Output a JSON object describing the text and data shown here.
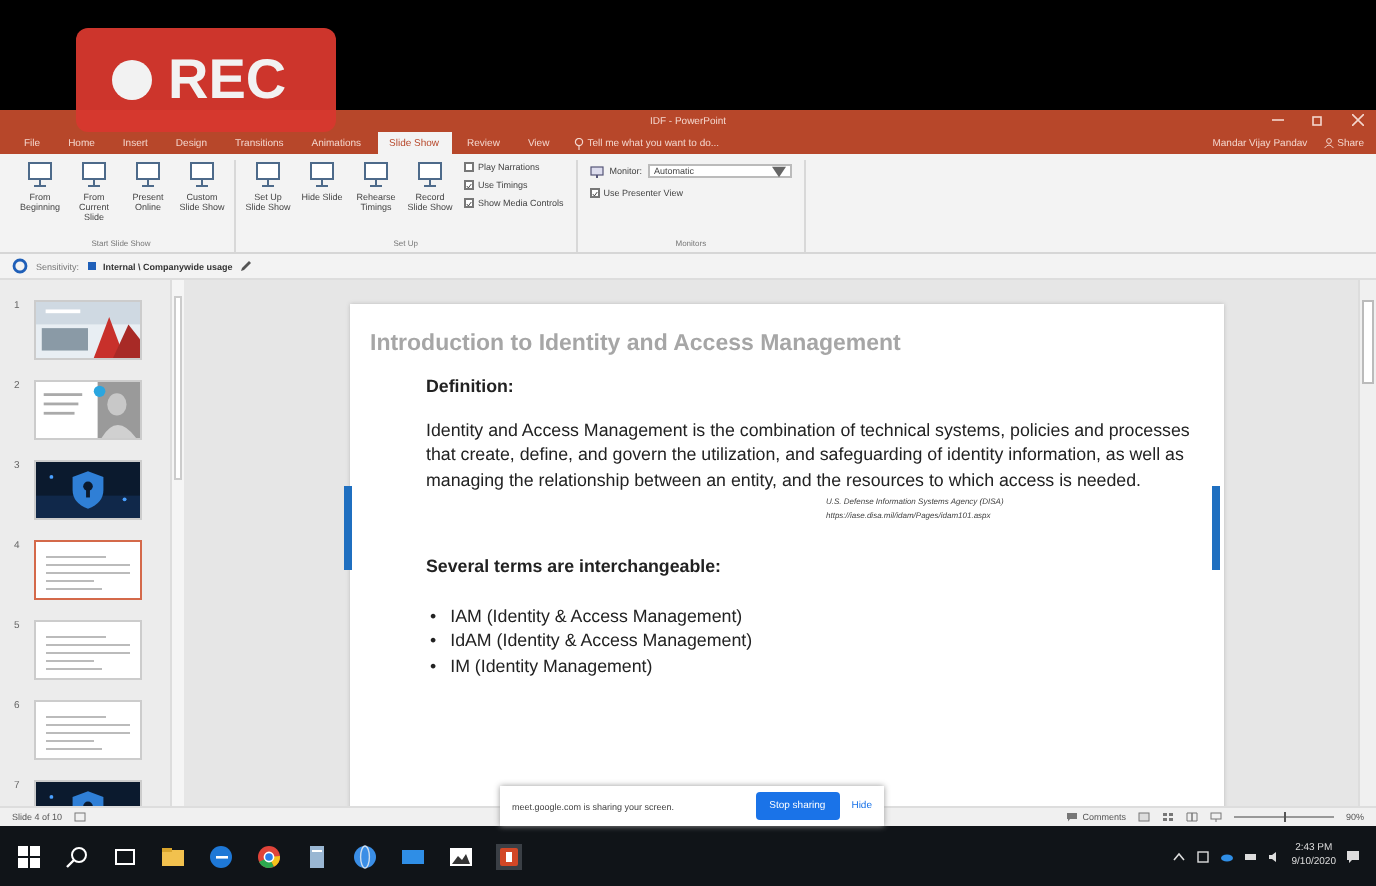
{
  "recording": {
    "label": "REC"
  },
  "window": {
    "title": "IDF - PowerPoint",
    "user": "Mandar Vijay Pandav",
    "share": "Share"
  },
  "menu_tabs": [
    {
      "label": "File",
      "selected": false
    },
    {
      "label": "Home",
      "selected": false
    },
    {
      "label": "Insert",
      "selected": false
    },
    {
      "label": "Design",
      "selected": false
    },
    {
      "label": "Transitions",
      "selected": false
    },
    {
      "label": "Animations",
      "selected": false
    },
    {
      "label": "Slide Show",
      "selected": true
    },
    {
      "label": "Review",
      "selected": false
    },
    {
      "label": "View",
      "selected": false
    }
  ],
  "tell_me": {
    "placeholder": "Tell me what you want to do..."
  },
  "ribbon_groups": [
    {
      "label": "Start Slide Show",
      "items": [
        {
          "kind": "button",
          "label": "From Beginning"
        },
        {
          "kind": "button",
          "label": "From Current Slide"
        },
        {
          "kind": "button",
          "label": "Present Online"
        },
        {
          "kind": "button",
          "label": "Custom Slide Show"
        }
      ]
    },
    {
      "label": "Set Up",
      "items": [
        {
          "kind": "button",
          "label": "Set Up Slide Show"
        },
        {
          "kind": "button",
          "label": "Hide Slide"
        },
        {
          "kind": "button",
          "label": "Rehearse Timings"
        },
        {
          "kind": "button",
          "label": "Record Slide Show"
        },
        {
          "kind": "checks",
          "checks": [
            {
              "label": "Play Narrations",
              "checked": false
            },
            {
              "label": "Use Timings",
              "checked": true
            },
            {
              "label": "Show Media Controls",
              "checked": true
            }
          ]
        }
      ]
    },
    {
      "label": "Monitors",
      "items": [
        {
          "kind": "dropdown",
          "label": "Monitor:",
          "value": "Automatic"
        },
        {
          "kind": "checks",
          "checks": [
            {
              "label": "Use Presenter View",
              "checked": true
            }
          ]
        }
      ]
    }
  ],
  "sensitivity": {
    "label": "Sensitivity:",
    "value": "Internal \\ Companywide usage"
  },
  "thumbnails": [
    {
      "number": "1",
      "kind": "picture",
      "selected": false
    },
    {
      "number": "2",
      "kind": "picture",
      "selected": false
    },
    {
      "number": "3",
      "kind": "picture",
      "selected": false
    },
    {
      "number": "4",
      "kind": "text",
      "selected": true
    },
    {
      "number": "5",
      "kind": "text",
      "selected": false
    },
    {
      "number": "6",
      "kind": "text",
      "selected": false
    },
    {
      "number": "7",
      "kind": "picture",
      "selected": false
    }
  ],
  "slide": {
    "title": "Introduction to Identity and Access Management",
    "heading": "Definition:",
    "paragraph": "Identity and Access Management is the combination of technical systems, policies and processes that create, define, and govern the utilization, and safeguarding of identity information, as well as managing the relationship between an entity, and the resources to which access is needed.",
    "source": [
      "U.S. Defense Information Systems Agency (DISA)",
      "https://iase.disa.mil/idam/Pages/idam101.aspx"
    ],
    "subheading": "Several terms are interchangeable:",
    "bullets": [
      {
        "marker": "•",
        "text": "IAM (Identity & Access Management)"
      },
      {
        "marker": "•",
        "text": "IdAM (Identity & Access Management)"
      },
      {
        "marker": "•",
        "text": "IM (Identity Management)"
      }
    ]
  },
  "status_bar": {
    "slide_info": "Slide 4 of 10",
    "comments": "Comments",
    "zoom_slider": {
      "level": 0.5
    },
    "zoom": "90%"
  },
  "share_notice": {
    "message": "meet.google.com is sharing your screen.",
    "stop": "Stop sharing",
    "hide": "Hide"
  },
  "taskbar": {
    "time": "2:43 PM",
    "date": "9/10/2020"
  }
}
